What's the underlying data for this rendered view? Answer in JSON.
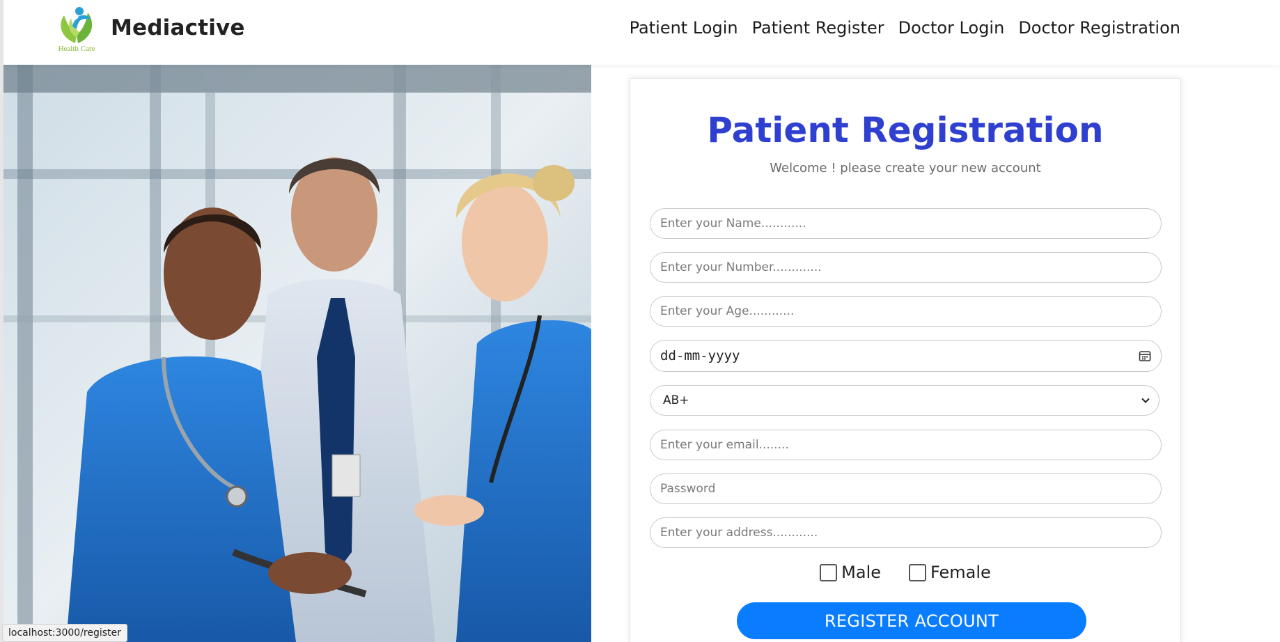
{
  "brand": {
    "name": "Mediactive",
    "logo_caption": "Health Care"
  },
  "nav": {
    "items": [
      "Patient Login",
      "Patient Register",
      "Doctor Login",
      "Doctor Registration"
    ]
  },
  "form": {
    "title": "Patient Registration",
    "subtitle": "Welcome ! please create your new account",
    "name_placeholder": "Enter your Name............",
    "number_placeholder": "Enter your Number.............",
    "age_placeholder": "Enter your Age............",
    "date_value": "dd-mm-yyyy",
    "blood_group_selected": "AB+",
    "email_placeholder": "Enter your email........",
    "password_placeholder": "Password",
    "address_placeholder": "Enter your address............",
    "gender_options": [
      "Male",
      "Female"
    ],
    "submit_label": "REGISTER ACCOUNT"
  },
  "status_bar": {
    "url": "localhost:3000/register"
  },
  "colors": {
    "title": "#2f3fd0",
    "button": "#0a7cff",
    "scrubs": "#1e6fc9"
  }
}
